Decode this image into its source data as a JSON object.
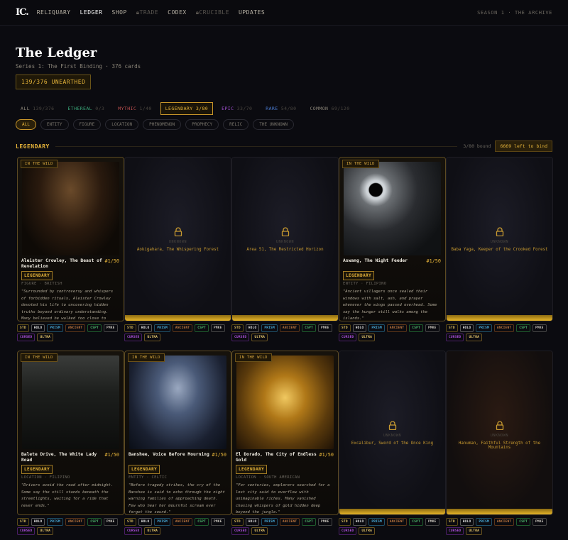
{
  "nav": {
    "logo": "IC.",
    "items": [
      {
        "label": "RELIQUARY",
        "state": "normal"
      },
      {
        "label": "LEDGER",
        "state": "active"
      },
      {
        "label": "SHOP",
        "state": "normal"
      },
      {
        "label": "TRADE",
        "state": "locked"
      },
      {
        "label": "CODEX",
        "state": "normal"
      },
      {
        "label": "CRUCIBLE",
        "state": "locked"
      },
      {
        "label": "UPDATES",
        "state": "normal"
      }
    ],
    "season": "SEASON 1 · THE ARCHIVE"
  },
  "header": {
    "title": "The Ledger",
    "subtitle": "Series 1: The First Binding · 376 cards",
    "unearthed": "139/376 UNEARTHED"
  },
  "rarity_tabs": [
    {
      "name": "ALL",
      "count": "139/376",
      "color": "#8a8478"
    },
    {
      "name": "ETHEREAL",
      "count": "0/3",
      "color": "#3aa87a"
    },
    {
      "name": "MYTHIC",
      "count": "1/40",
      "color": "#c05050"
    },
    {
      "name": "LEGENDARY",
      "count": "3/80",
      "color": "#e6b43a",
      "selected": true
    },
    {
      "name": "EPIC",
      "count": "33/70",
      "color": "#a050d0"
    },
    {
      "name": "RARE",
      "count": "54/80",
      "color": "#4a7ad0"
    },
    {
      "name": "COMMON",
      "count": "69/120",
      "color": "#8a8478"
    }
  ],
  "type_filters": [
    "ALL",
    "ENTITY",
    "FIGURE",
    "LOCATION",
    "PHENOMENON",
    "PROPHECY",
    "RELIC",
    "THE UNKNOWN"
  ],
  "section": {
    "label": "LEGENDARY",
    "bound": "3/80 bound",
    "left": "6669 left to bind"
  },
  "tag_labels": {
    "std": "STD",
    "holo": "HOLO",
    "prism": "PRISM",
    "anc": "ANCIENT",
    "cspt": "CSPT",
    "pmk": "PMKE",
    "cursed": "CURSED",
    "ultra": "ULTRA"
  },
  "cards": [
    {
      "state": "found",
      "badge": "IN THE WILD",
      "name": "Aleister Crowley, The Beast of Revelation",
      "num": "#1/50",
      "rarity": "LEGENDARY",
      "meta": "FIGURE · BRITISH",
      "quote": "\"Surrounded by controversy and whispers of forbidden rituals, Aleister Crowley devoted his life to uncovering hidden truths beyond ordinary understanding. Many believed he walked too close to forces mankind was never"
    },
    {
      "state": "locked",
      "unknown": "UNKNOWN",
      "name": "Aokigahara, The Whispering Forest"
    },
    {
      "state": "locked",
      "unknown": "UNKNOWN",
      "name": "Area 51, The Restricted Horizon"
    },
    {
      "state": "found",
      "badge": "IN THE WILD",
      "name": "Aswang, The Night Feeder",
      "num": "#1/50",
      "rarity": "LEGENDARY",
      "meta": "ENTITY · FILIPINO",
      "quote": "\"Ancient villagers once sealed their windows with salt, ash, and prayer whenever the wings passed overhead. Some say the hunger still walks among the islands.\""
    },
    {
      "state": "locked",
      "unknown": "UNKNOWN",
      "name": "Baba Yaga, Keeper of the Crooked Forest"
    },
    {
      "state": "found",
      "badge": "IN THE WILD",
      "name": "Balete Drive, The White Lady Road",
      "num": "#1/50",
      "rarity": "LEGENDARY",
      "meta": "LOCATION · FILIPINO",
      "quote": "\"Drivers avoid the road after midnight. Some say the still stands beneath the streetlights, waiting for a ride that never ends.\""
    },
    {
      "state": "found",
      "badge": "IN THE WILD",
      "name": "Banshee, Voice Before Mourning",
      "num": "#1/50",
      "rarity": "LEGENDARY",
      "meta": "ENTITY · CELTIC",
      "quote": "\"Before tragedy strikes, the cry of the Banshee is said to echo through the night warning families of approaching death. Few who hear her mournful scream ever forget the sound.\""
    },
    {
      "state": "found",
      "badge": "IN THE WILD",
      "name": "El Dorado, The City of Endless Gold",
      "num": "#1/50",
      "rarity": "LEGENDARY",
      "meta": "LOCATION · SOUTH AMERICAN",
      "quote": "\"For centuries, explorers searched for a lost city said to overflow with unimaginable riches. Many vanished chasing whispers of gold hidden deep beyond the jungle.\""
    },
    {
      "state": "locked",
      "unknown": "UNKNOWN",
      "name": "Excalibur, Sword of the Once King"
    },
    {
      "state": "locked",
      "unknown": "UNKNOWN",
      "name": "Hanuman, Faithful Strength of the Mountains",
      "warm": true
    }
  ]
}
